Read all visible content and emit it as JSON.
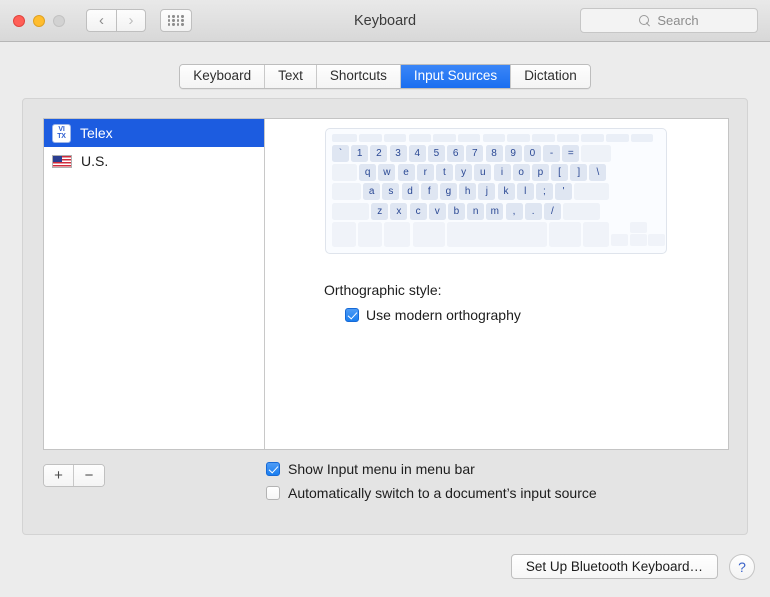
{
  "window": {
    "title": "Keyboard",
    "traffic_lights": [
      "close",
      "minimize",
      "zoom"
    ]
  },
  "toolbar": {
    "back_icon": "‹",
    "forward_icon": "›",
    "grid_icon": "grid-view-icon",
    "search": {
      "placeholder": "Search",
      "value": ""
    }
  },
  "tabs": [
    {
      "label": "Keyboard",
      "active": false
    },
    {
      "label": "Text",
      "active": false
    },
    {
      "label": "Shortcuts",
      "active": false
    },
    {
      "label": "Input Sources",
      "active": true
    },
    {
      "label": "Dictation",
      "active": false
    }
  ],
  "input_sources": [
    {
      "name": "Telex",
      "icon": "telex-vi-tx-icon",
      "selected": true
    },
    {
      "name": "U.S.",
      "icon": "us-flag-icon",
      "selected": false
    }
  ],
  "list_buttons": {
    "add_label": "+",
    "remove_label": "−"
  },
  "keyboard_preview": {
    "rows": [
      {
        "type": "function",
        "keys": [
          "",
          "",
          "",
          "",
          "",
          "",
          "",
          "",
          "",
          "",
          "",
          "",
          ""
        ]
      },
      {
        "type": "number",
        "keys": [
          "`",
          "1",
          "2",
          "3",
          "4",
          "5",
          "6",
          "7",
          "8",
          "9",
          "0",
          "-",
          "="
        ]
      },
      {
        "type": "top",
        "keys": [
          "q",
          "w",
          "e",
          "r",
          "t",
          "y",
          "u",
          "i",
          "o",
          "p",
          "[",
          "]",
          "\\"
        ]
      },
      {
        "type": "home",
        "keys": [
          "a",
          "s",
          "d",
          "f",
          "g",
          "h",
          "j",
          "k",
          "l",
          ";",
          "'"
        ]
      },
      {
        "type": "bottom_letters",
        "keys": [
          "z",
          "x",
          "c",
          "v",
          "b",
          "n",
          "m",
          ",",
          ".",
          "/"
        ]
      },
      {
        "type": "modifiers",
        "keys": [
          "",
          "",
          "",
          "",
          "",
          ""
        ]
      }
    ]
  },
  "orthographic": {
    "label": "Orthographic style:",
    "option_label": "Use modern orthography",
    "checked": true
  },
  "options": [
    {
      "label": "Show Input menu in menu bar",
      "checked": true
    },
    {
      "label": "Automatically switch to a document’s input source",
      "checked": false
    }
  ],
  "footer": {
    "bluetooth_button": "Set Up Bluetooth Keyboard…",
    "help_button": "?"
  },
  "colors": {
    "accent_blue": "#1a6ef0",
    "selection_blue": "#1c5ce0",
    "key_text": "#2a4894",
    "window_bg": "#ececec"
  }
}
